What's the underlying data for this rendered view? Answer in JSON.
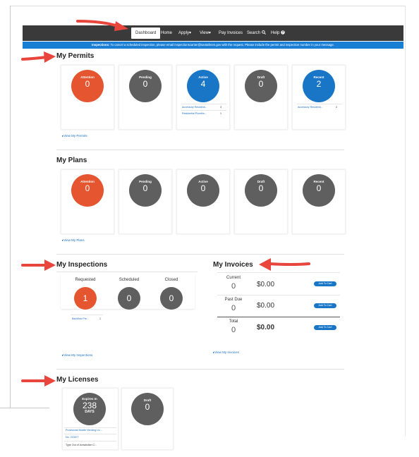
{
  "nav": {
    "items": [
      {
        "label": "Dashboard",
        "active": true
      },
      {
        "label": "Home"
      },
      {
        "label": "Apply▾"
      },
      {
        "label": "View▾"
      },
      {
        "label": "Pay Invoices"
      },
      {
        "label": "Search"
      },
      {
        "label": "Help"
      }
    ]
  },
  "notice": {
    "strong": "Inspections:",
    "text": "To cancel a scheduled inspection, please email inspectionscanter@santafenm.gov with the request.  Please include the permit and inspection number in your message."
  },
  "permits": {
    "title": "My Permits",
    "cards": [
      {
        "label": "Attention",
        "count": "0",
        "color": "#e5552f"
      },
      {
        "label": "Pending",
        "count": "0",
        "color": "#5f5f5f"
      },
      {
        "label": "Active",
        "count": "4",
        "color": "#1976c7",
        "rows": [
          {
            "text": "Accessory Residenti...",
            "count": "3"
          },
          {
            "text": "Residential Plumbin...",
            "count": "1"
          }
        ]
      },
      {
        "label": "Draft",
        "count": "0",
        "color": "#5f5f5f"
      },
      {
        "label": "Recent",
        "count": "2",
        "color": "#1976c7",
        "rows": [
          {
            "text": "Accessory Residenti...",
            "count": "2"
          }
        ]
      }
    ],
    "link": "▸View My Permits"
  },
  "plans": {
    "title": "My Plans",
    "cards": [
      {
        "label": "Attention",
        "count": "0",
        "color": "#e5552f"
      },
      {
        "label": "Pending",
        "count": "0",
        "color": "#5f5f5f"
      },
      {
        "label": "Active",
        "count": "0",
        "color": "#5f5f5f"
      },
      {
        "label": "Draft",
        "count": "0",
        "color": "#5f5f5f"
      },
      {
        "label": "Recent",
        "count": "0",
        "color": "#5f5f5f"
      }
    ],
    "link": "▸View My Plans"
  },
  "inspections": {
    "title": "My Inspections",
    "columns": [
      {
        "label": "Requested",
        "count": "1",
        "color": "#e5552f",
        "rows": [
          {
            "text": "Backflow Pre...",
            "count": "1"
          }
        ]
      },
      {
        "label": "Scheduled",
        "count": "0",
        "color": "#5f5f5f"
      },
      {
        "label": "Closed",
        "count": "0",
        "color": "#5f5f5f"
      }
    ],
    "link": "▸View My Inspections"
  },
  "invoices": {
    "title": "My Invoices",
    "rows": [
      {
        "label": "Current",
        "count": "0",
        "amount": "$0.00",
        "button": "Add To Cart"
      },
      {
        "label": "Past Due",
        "count": "0",
        "amount": "$0.00",
        "button": "Add To Cart"
      },
      {
        "label": "Total",
        "count": "0",
        "amount": "$0.00",
        "button": "Add To Cart"
      }
    ],
    "link": "▸View My Invoices"
  },
  "licenses": {
    "title": "My Licenses",
    "cards": [
      {
        "label": "Expires In",
        "count": "238",
        "unit": "DAYS",
        "color": "#5f5f5f",
        "rows": [
          {
            "text": "Provisional Mobile Vending Lic..."
          },
          {
            "text": "No. 223577"
          },
          {
            "text": "Type  Out of Jurisdiction C..."
          }
        ]
      },
      {
        "label": "Draft",
        "count": "0",
        "color": "#5f5f5f"
      }
    ]
  },
  "colors": {
    "arrow": "#e8453c",
    "nav_bg": "#3a3a3a",
    "notice_bg": "#1a7fd4"
  }
}
